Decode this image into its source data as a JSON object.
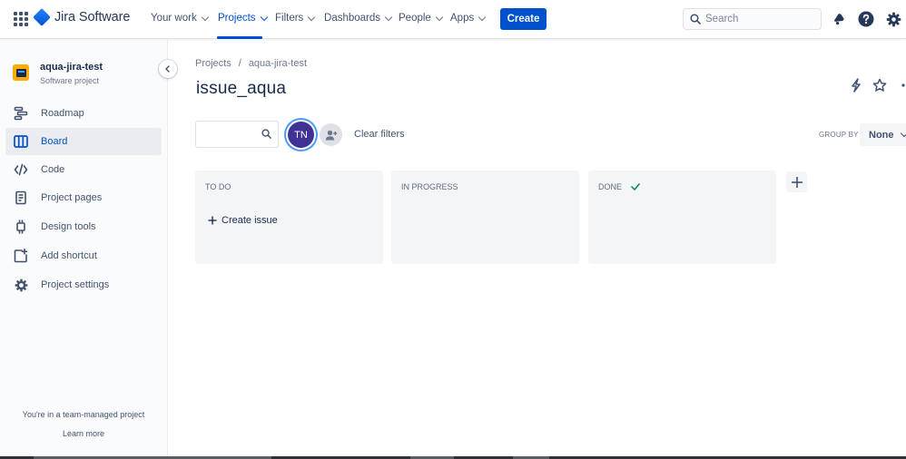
{
  "topnav": {
    "product_name": "Jira Software",
    "menu": [
      {
        "label": "Your work"
      },
      {
        "label": "Projects"
      },
      {
        "label": "Filters"
      },
      {
        "label": "Dashboards"
      },
      {
        "label": "People"
      },
      {
        "label": "Apps"
      }
    ],
    "active_menu": "Projects",
    "create_label": "Create",
    "search_placeholder": "Search",
    "icons": [
      "app-switcher-icon",
      "notifications-icon",
      "help-icon",
      "settings-icon"
    ],
    "accent_color": "#0052CC"
  },
  "sidebar": {
    "project_name": "aqua-jira-test",
    "project_type": "Software project",
    "items": [
      {
        "label": "Roadmap",
        "icon": "roadmap-icon"
      },
      {
        "label": "Board",
        "icon": "board-icon",
        "selected": true
      },
      {
        "label": "Code",
        "icon": "code-icon"
      },
      {
        "label": "Project pages",
        "icon": "pages-icon"
      },
      {
        "label": "Design tools",
        "icon": "design-tools-icon"
      },
      {
        "label": "Add shortcut",
        "icon": "add-shortcut-icon"
      },
      {
        "label": "Project settings",
        "icon": "settings-icon"
      }
    ],
    "footer_text": "You're in a team-managed project",
    "footer_link": "Learn more"
  },
  "main": {
    "breadcrumb": [
      "Projects",
      "aqua-jira-test"
    ],
    "title": "issue_aqua",
    "filter_search_value": "",
    "avatar_initials": "TN",
    "clear_filters": "Clear filters",
    "group_by_label": "GROUP BY",
    "group_by_value": "None",
    "columns": [
      {
        "title": "TO DO",
        "action": "Create issue"
      },
      {
        "title": "IN PROGRESS"
      },
      {
        "title": "DONE",
        "done_check": true
      }
    ]
  }
}
